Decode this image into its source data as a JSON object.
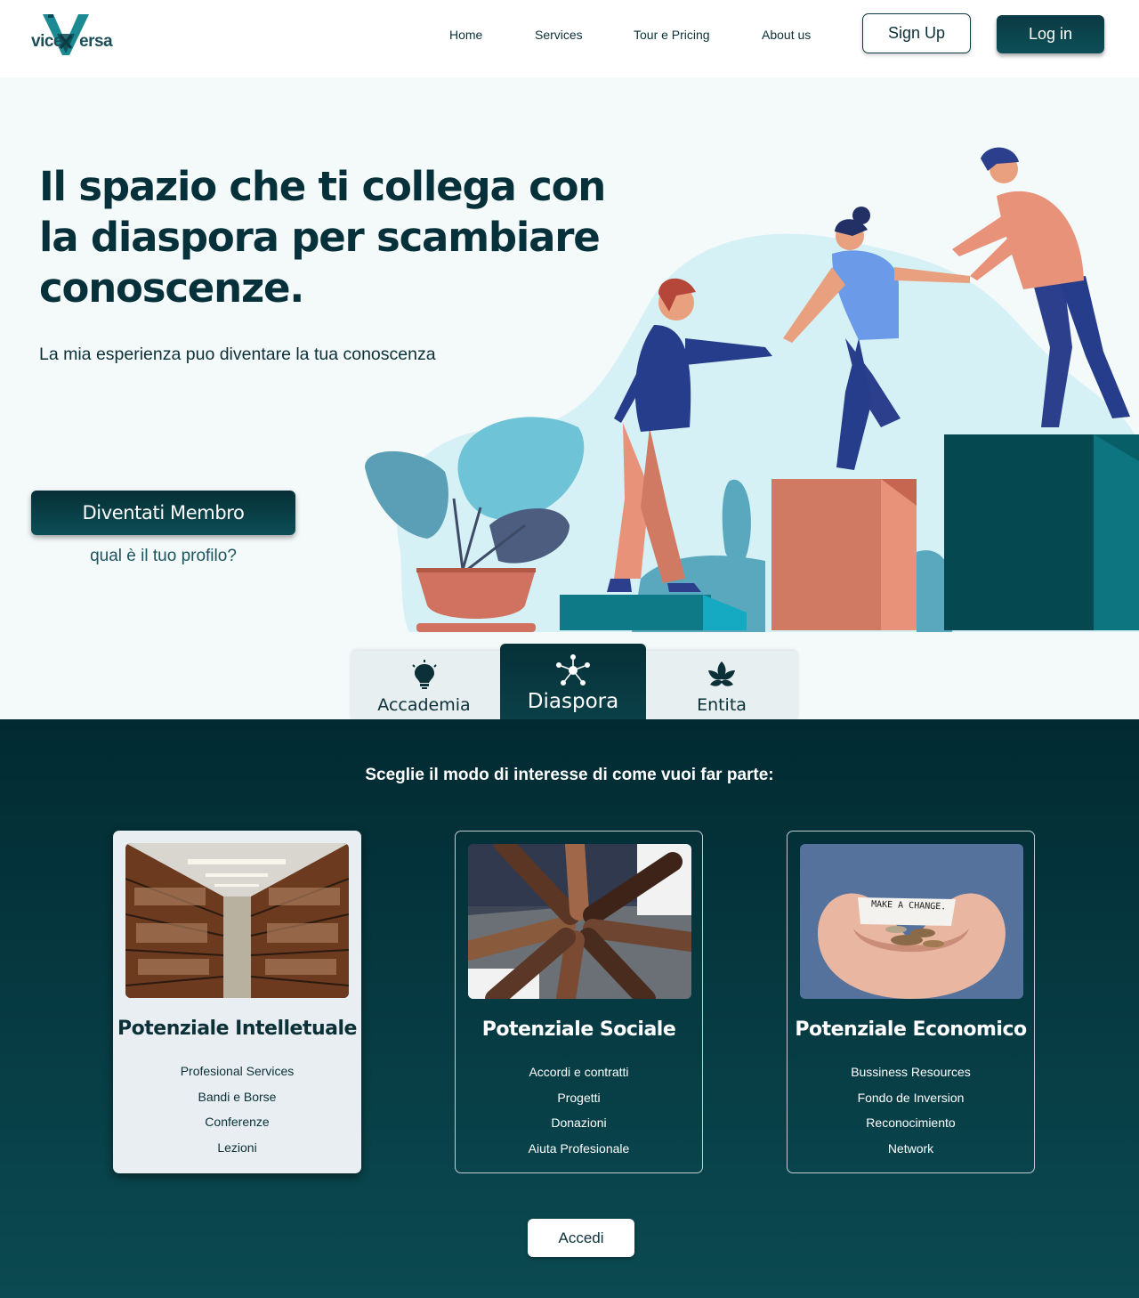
{
  "brand": {
    "logo_left": "vice",
    "logo_right": "ersa"
  },
  "nav": {
    "links": [
      "Home",
      "Services",
      "Tour e Pricing",
      "About us"
    ],
    "signup": "Sign Up",
    "login": "Log in"
  },
  "hero": {
    "title": "Il spazio che ti collega con la diaspora per scambiare conoscenze.",
    "subtitle": "La mia esperienza puo diventare la tua conoscenza",
    "cta": "Diventati Membro",
    "profile_question": "qual è il tuo profilo?"
  },
  "tabs": [
    {
      "label": "Accademia",
      "icon": "lightbulb-icon",
      "active": false
    },
    {
      "label": "Diaspora",
      "icon": "network-icon",
      "active": true
    },
    {
      "label": "Entita",
      "icon": "leaf-icon",
      "active": false
    }
  ],
  "section": {
    "title": "Sceglie il modo di interesse di come vuoi far parte:",
    "cards": [
      {
        "title": "Potenziale Intelletuale",
        "image": "library-shelves",
        "selected": true,
        "items": [
          "Profesional Services",
          "Bandi e Borse",
          "Conferenze",
          "Lezioni"
        ]
      },
      {
        "title": "Potenziale Sociale",
        "image": "fist-bump-circle",
        "selected": false,
        "items": [
          "Accordi e contratti",
          "Progetti",
          "Donazioni",
          "Aiuta Profesionale"
        ]
      },
      {
        "title": "Potenziale Economico",
        "image": "hands-with-coins",
        "selected": false,
        "items": [
          "Bussiness Resources",
          "Fondo de Inversion",
          "Reconocimiento",
          "Network"
        ]
      }
    ],
    "coin_note": "MAKE A CHANGE.",
    "action": "Accedi"
  },
  "colors": {
    "primary": "#0b3a43",
    "accent_teal": "#0e7a86",
    "salmon": "#e8937a",
    "blue": "#2b3f8c"
  }
}
